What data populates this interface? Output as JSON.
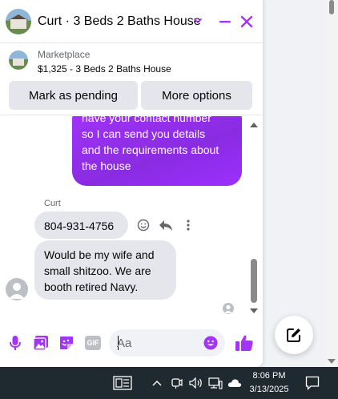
{
  "colors": {
    "accent": "#a334fa",
    "outgoing_bubble": "#9b30ff",
    "incoming_bubble": "#e4e6eb",
    "secondary_text": "#65676b",
    "taskbar": "#1f2a30"
  },
  "header": {
    "title": "Curt · 3 Beds 2 Baths House",
    "icons": [
      "house-avatar",
      "chevron-down-icon",
      "minimize-icon",
      "close-icon"
    ]
  },
  "marketplace": {
    "label": "Marketplace",
    "listing": "$1,325 - 3 Beds 2 Baths House",
    "pending_button": "Mark as pending",
    "options_button": "More options"
  },
  "messages": {
    "outgoing": {
      "lines": [
        "have your contact number",
        "so I can send you details",
        "and the requirements about",
        "the house"
      ]
    },
    "sender_name": "Curt",
    "incoming": [
      {
        "text": "804-931-4756"
      },
      {
        "lines": [
          "Would be my wife and",
          "small shitzoo.  We are",
          "booth retired Navy."
        ]
      }
    ],
    "action_icons": [
      "react-emoji-icon",
      "reply-icon",
      "more-icon"
    ]
  },
  "composer": {
    "placeholder": "Aa",
    "value": "",
    "icons": [
      "microphone-icon",
      "photo-icon",
      "sticker-icon",
      "gif-icon",
      "emoji-icon",
      "like-icon"
    ],
    "gif_label": "GIF"
  },
  "taskbar": {
    "time": "8:06 PM",
    "date": "3/13/2025",
    "icons": [
      "task-view-icon",
      "chevron-up-icon",
      "meet-now-icon",
      "volume-icon",
      "network-icon",
      "weather-icon",
      "notification-icon"
    ]
  }
}
